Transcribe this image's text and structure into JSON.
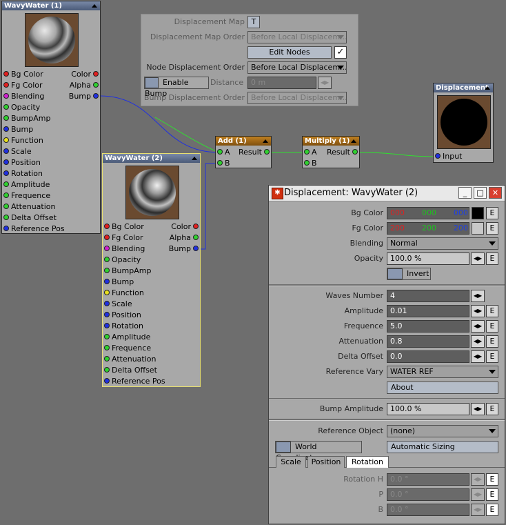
{
  "top_panel": {
    "displacement_map_label": "Displacement Map",
    "displacement_map_button": "T",
    "displacement_map_order_label": "Displacement Map Order",
    "displacement_map_order_value": "Before Local Displacem...",
    "edit_nodes_label": "Edit Nodes",
    "edit_nodes_check": "✓",
    "node_displacement_order_label": "Node Displacement Order",
    "node_displacement_order_value": "Before Local Displacem...",
    "enable_bump_label": "Enable Bump",
    "distance_label": "Distance",
    "distance_value": "0 m",
    "bump_displacement_order_label": "Bump Displacement Order",
    "bump_displacement_order_value": "Before Local Displacem..."
  },
  "nodes": {
    "wavy1": {
      "title": "WavyWater (1)",
      "inputs": [
        "Bg Color",
        "Fg Color",
        "Blending",
        "Opacity",
        "BumpAmp",
        "Bump",
        "Function",
        "Scale",
        "Position",
        "Rotation",
        "Amplitude",
        "Frequence",
        "Attenuation",
        "Delta Offset",
        "Reference Pos"
      ],
      "outputs": [
        "Color",
        "Alpha",
        "Bump"
      ]
    },
    "wavy2": {
      "title": "WavyWater (2)",
      "inputs": [
        "Bg Color",
        "Fg Color",
        "Blending",
        "Opacity",
        "BumpAmp",
        "Bump",
        "Function",
        "Scale",
        "Position",
        "Rotation",
        "Amplitude",
        "Frequence",
        "Attenuation",
        "Delta Offset",
        "Reference Pos"
      ],
      "outputs": [
        "Color",
        "Alpha",
        "Bump"
      ]
    },
    "add": {
      "title": "Add (1)",
      "in_a": "A",
      "in_b": "B",
      "out": "Result"
    },
    "multiply": {
      "title": "Multiply (1)",
      "in_a": "A",
      "in_b": "B",
      "out": "Result"
    },
    "displacement": {
      "title": "Displacement",
      "input": "Input"
    }
  },
  "dialog": {
    "title": "Displacement: WavyWater (2)",
    "minimize": "_",
    "maximize": "□",
    "close": "✕",
    "bg_color_label": "Bg Color",
    "bg_color": [
      "000",
      "000",
      "000"
    ],
    "fg_color_label": "Fg Color",
    "fg_color": [
      "200",
      "200",
      "200"
    ],
    "blending_label": "Blending",
    "blending_value": "Normal",
    "opacity_label": "Opacity",
    "opacity_value": "100.0 %",
    "invert_label": "Invert",
    "waves_number_label": "Waves Number",
    "waves_number_value": "4",
    "amplitude_label": "Amplitude",
    "amplitude_value": "0.01",
    "frequence_label": "Frequence",
    "frequence_value": "5.0",
    "attenuation_label": "Attenuation",
    "attenuation_value": "0.8",
    "delta_offset_label": "Delta Offset",
    "delta_offset_value": "0.0",
    "reference_vary_label": "Reference Vary",
    "reference_vary_value": "WATER REF",
    "about_label": "About",
    "bump_amplitude_label": "Bump Amplitude",
    "bump_amplitude_value": "100.0 %",
    "reference_object_label": "Reference Object",
    "reference_object_value": "(none)",
    "world_coordinates_label": "World Coordinates",
    "automatic_sizing_label": "Automatic Sizing",
    "tabs": [
      "Scale",
      "Position",
      "Rotation"
    ],
    "rotation_h_label": "Rotation H",
    "rotation_h_value": "0.0 °",
    "p_label": "P",
    "p_value": "0.0 °",
    "b_label": "B",
    "b_value": "0.0 °",
    "e_label": "E",
    "spin_label": "◀▶"
  },
  "colors": {
    "background": "#6e6e6e",
    "node_body": "#a8a8a8",
    "math_node_title": "#a06818",
    "selected_border": "#e8e070",
    "wire_green": "#30e030",
    "wire_blue": "#2030e0",
    "red_text": "#e02020",
    "green_text": "#20c020",
    "blue_text": "#2040e0"
  }
}
